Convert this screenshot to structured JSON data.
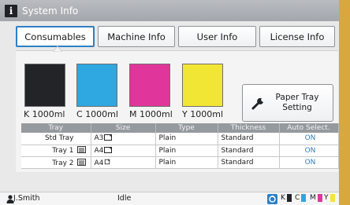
{
  "window": {
    "title": "System Info",
    "title_icon": "info-icon"
  },
  "tabs": [
    {
      "label": "Consumables",
      "active": true
    },
    {
      "label": "Machine Info",
      "active": false
    },
    {
      "label": "User Info",
      "active": false
    },
    {
      "label": "License Info",
      "active": false
    }
  ],
  "inks": [
    {
      "letter": "K",
      "amount": "1000ml",
      "color": "#222427"
    },
    {
      "letter": "C",
      "amount": "1000ml",
      "color": "#2fa7e0"
    },
    {
      "letter": "M",
      "amount": "1000ml",
      "color": "#e0359a"
    },
    {
      "letter": "Y",
      "amount": "1000ml",
      "color": "#f2e635"
    }
  ],
  "paper_tray_setting": {
    "line1": "Paper Tray",
    "line2": "Setting",
    "icon": "wrench-icon"
  },
  "tray_table": {
    "columns": [
      "Tray",
      "Size",
      "Type",
      "Thickness",
      "Auto Select."
    ],
    "rows": [
      {
        "tray": "Std Tray",
        "size": "A3",
        "type": "Plain",
        "thickness": "Standard",
        "auto": "ON"
      },
      {
        "tray": "Tray 1",
        "size": "A4",
        "type": "Plain",
        "thickness": "Standard",
        "auto": "ON"
      },
      {
        "tray": "Tray 2",
        "size": "A4",
        "type": "Plain",
        "thickness": "Standard",
        "auto": "ON"
      }
    ]
  },
  "status": {
    "user": "J.Smith",
    "state": "Idle",
    "levels": [
      {
        "letter": "K",
        "color": "#222427"
      },
      {
        "letter": "C",
        "color": "#2fa7e0"
      },
      {
        "letter": "M",
        "color": "#e0359a"
      },
      {
        "letter": "Y",
        "color": "#f2e635"
      }
    ]
  },
  "colors": {
    "accent": "#2e7fc4",
    "header": "#959a9f",
    "bezel": "#d9a640"
  }
}
